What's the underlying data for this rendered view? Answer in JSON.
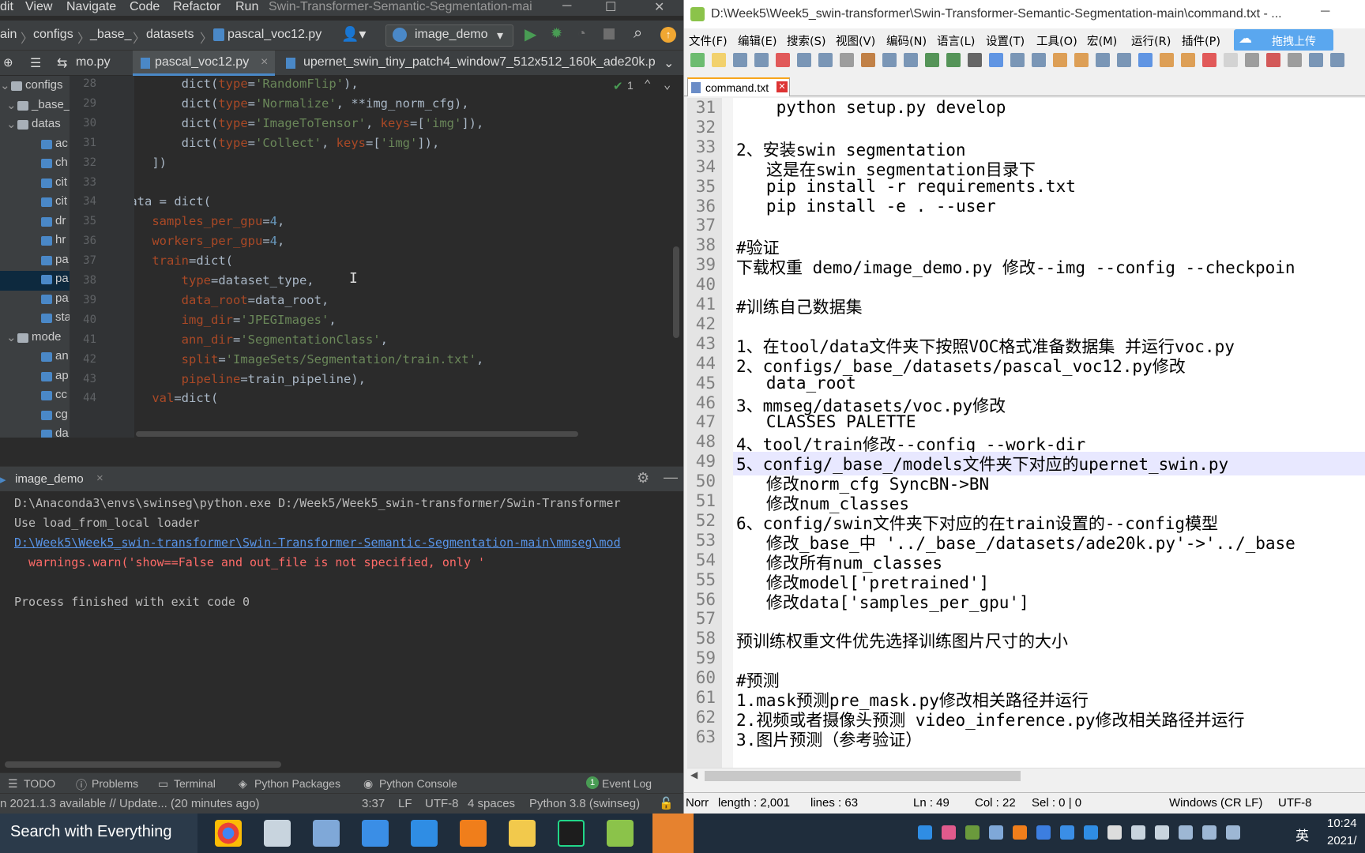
{
  "ide": {
    "menu": [
      "dit",
      "View",
      "Navigate",
      "Code",
      "Refactor",
      "Run"
    ],
    "window_title": "Swin-Transformer-Semantic-Segmentation-mai",
    "breadcrumbs": [
      "ain",
      "configs",
      "_base_",
      "datasets",
      "pascal_voc12.py"
    ],
    "run_config": "image_demo",
    "tabs": [
      "mo.py",
      "pascal_voc12.py",
      "upernet_swin_tiny_patch4_window7_512x512_160k_ade20k.p"
    ],
    "inspection_count": "1",
    "tree": [
      {
        "label": "configs",
        "indent": 0,
        "icon": "folder",
        "sel": false
      },
      {
        "label": "_base_",
        "indent": 1,
        "icon": "folder",
        "sel": false
      },
      {
        "label": "datas",
        "indent": 1,
        "icon": "folder",
        "sel": false
      },
      {
        "label": "ac",
        "indent": 2,
        "icon": "py",
        "sel": false
      },
      {
        "label": "ch",
        "indent": 2,
        "icon": "py",
        "sel": false
      },
      {
        "label": "cit",
        "indent": 2,
        "icon": "py",
        "sel": false
      },
      {
        "label": "cit",
        "indent": 2,
        "icon": "py",
        "sel": false
      },
      {
        "label": "dr",
        "indent": 2,
        "icon": "py",
        "sel": false
      },
      {
        "label": "hr",
        "indent": 2,
        "icon": "py",
        "sel": false
      },
      {
        "label": "pa",
        "indent": 2,
        "icon": "py",
        "sel": false
      },
      {
        "label": "pa",
        "indent": 2,
        "icon": "py",
        "sel": true
      },
      {
        "label": "pa",
        "indent": 2,
        "icon": "py",
        "sel": false
      },
      {
        "label": "sta",
        "indent": 2,
        "icon": "py",
        "sel": false
      },
      {
        "label": "mode",
        "indent": 1,
        "icon": "folder",
        "sel": false
      },
      {
        "label": "an",
        "indent": 2,
        "icon": "py",
        "sel": false
      },
      {
        "label": "ap",
        "indent": 2,
        "icon": "py",
        "sel": false
      },
      {
        "label": "cc",
        "indent": 2,
        "icon": "py",
        "sel": false
      },
      {
        "label": "cg",
        "indent": 2,
        "icon": "py",
        "sel": false
      },
      {
        "label": "da",
        "indent": 2,
        "icon": "py",
        "sel": false
      },
      {
        "label": "de",
        "indent": 2,
        "icon": "py",
        "sel": false
      }
    ],
    "line_numbers": [
      "28",
      "29",
      "30",
      "31",
      "32",
      "33",
      "34",
      "35",
      "36",
      "37",
      "38",
      "39",
      "40",
      "41",
      "42",
      "43",
      "44"
    ],
    "code": [
      [
        [
          "        dict(",
          ""
        ],
        [
          "type",
          "pa"
        ],
        [
          "=",
          ""
        ],
        [
          "'RandomFlip'",
          "st"
        ],
        [
          "),",
          ""
        ]
      ],
      [
        [
          "        dict(",
          ""
        ],
        [
          "type",
          "pa"
        ],
        [
          "=",
          ""
        ],
        [
          "'Normalize'",
          "st"
        ],
        [
          ", **img_norm_cfg),",
          ""
        ]
      ],
      [
        [
          "        dict(",
          ""
        ],
        [
          "type",
          "pa"
        ],
        [
          "=",
          ""
        ],
        [
          "'ImageToTensor'",
          "st"
        ],
        [
          ", ",
          ""
        ],
        [
          "keys",
          "pa"
        ],
        [
          "=[",
          ""
        ],
        [
          "'img'",
          "st"
        ],
        [
          "]),",
          ""
        ]
      ],
      [
        [
          "        dict(",
          ""
        ],
        [
          "type",
          "pa"
        ],
        [
          "=",
          ""
        ],
        [
          "'Collect'",
          "st"
        ],
        [
          ", ",
          ""
        ],
        [
          "keys",
          "pa"
        ],
        [
          "=[",
          ""
        ],
        [
          "'img'",
          "st"
        ],
        [
          "]),",
          ""
        ]
      ],
      [
        [
          "    ])",
          ""
        ]
      ],
      [
        [
          "]",
          ""
        ]
      ],
      [
        [
          "data = dict(",
          ""
        ]
      ],
      [
        [
          "    ",
          ""
        ],
        [
          "samples_per_gpu",
          "pa"
        ],
        [
          "=",
          ""
        ],
        [
          "4",
          "nm"
        ],
        [
          ",",
          ""
        ]
      ],
      [
        [
          "    ",
          ""
        ],
        [
          "workers_per_gpu",
          "pa"
        ],
        [
          "=",
          ""
        ],
        [
          "4",
          "nm"
        ],
        [
          ",",
          ""
        ]
      ],
      [
        [
          "    ",
          ""
        ],
        [
          "train",
          "pa"
        ],
        [
          "=dict(",
          ""
        ]
      ],
      [
        [
          "        ",
          ""
        ],
        [
          "type",
          "pa"
        ],
        [
          "=dataset_type,",
          ""
        ]
      ],
      [
        [
          "        ",
          ""
        ],
        [
          "data_root",
          "pa"
        ],
        [
          "=data_root,",
          ""
        ]
      ],
      [
        [
          "        ",
          ""
        ],
        [
          "img_dir",
          "pa"
        ],
        [
          "=",
          ""
        ],
        [
          "'JPEGImages'",
          "st"
        ],
        [
          ",",
          ""
        ]
      ],
      [
        [
          "        ",
          ""
        ],
        [
          "ann_dir",
          "pa"
        ],
        [
          "=",
          ""
        ],
        [
          "'SegmentationClass'",
          "st"
        ],
        [
          ",",
          ""
        ]
      ],
      [
        [
          "        ",
          ""
        ],
        [
          "split",
          "pa"
        ],
        [
          "=",
          ""
        ],
        [
          "'ImageSets/Segmentation/train.txt'",
          "st"
        ],
        [
          ",",
          ""
        ]
      ],
      [
        [
          "        ",
          ""
        ],
        [
          "pipeline",
          "pa"
        ],
        [
          "=train_pipeline),",
          ""
        ]
      ],
      [
        [
          "    ",
          ""
        ],
        [
          "val",
          "pa"
        ],
        [
          "=dict(",
          ""
        ]
      ]
    ],
    "run_tab": "image_demo",
    "console": [
      {
        "text": "D:\\Anaconda3\\envs\\swinseg\\python.exe D:/Week5/Week5_swin-transformer/Swin-Transformer",
        "kind": "plain"
      },
      {
        "text": "Use load_from_local loader",
        "kind": "plain"
      },
      {
        "text": "D:\\Week5\\Week5_swin-transformer\\Swin-Transformer-Semantic-Segmentation-main\\mmseg\\mod",
        "kind": "link"
      },
      {
        "text": "  warnings.warn('show==False and out_file is not specified, only '",
        "kind": "warn"
      },
      {
        "text": "",
        "kind": "plain"
      },
      {
        "text": "Process finished with exit code 0",
        "kind": "plain"
      }
    ],
    "tool_windows": [
      "TODO",
      "Problems",
      "Terminal",
      "Python Packages",
      "Python Console",
      "Event Log"
    ],
    "status_left": "n 2021.1.3 available // Update... (20 minutes ago)",
    "status_right": [
      "3:37",
      "LF",
      "UTF-8",
      "4 spaces",
      "Python 3.8 (swinseg)"
    ]
  },
  "npp": {
    "title": "D:\\Week5\\Week5_swin-transformer\\Swin-Transformer-Semantic-Segmentation-main\\command.txt - ...",
    "menu": [
      "文件(F)",
      "编辑(E)",
      "搜索(S)",
      "视图(V)",
      "编码(N)",
      "语言(L)",
      "设置(T)",
      "工具(O)",
      "宏(M)",
      "运行(R)",
      "插件(P)"
    ],
    "cloud_button": "拖拽上传",
    "tab": "command.txt",
    "highlight_line": 49,
    "lines": [
      {
        "n": "31",
        "t": "    python setup.py develop"
      },
      {
        "n": "32",
        "t": ""
      },
      {
        "n": "33",
        "t": "2、安装swin segmentation"
      },
      {
        "n": "34",
        "t": "   这是在swin segmentation目录下"
      },
      {
        "n": "35",
        "t": "   pip install -r requirements.txt"
      },
      {
        "n": "36",
        "t": "   pip install -e . --user"
      },
      {
        "n": "37",
        "t": ""
      },
      {
        "n": "38",
        "t": "#验证"
      },
      {
        "n": "39",
        "t": "下载权重 demo/image_demo.py 修改--img --config --checkpoin"
      },
      {
        "n": "40",
        "t": ""
      },
      {
        "n": "41",
        "t": "#训练自己数据集"
      },
      {
        "n": "42",
        "t": ""
      },
      {
        "n": "43",
        "t": "1、在tool/data文件夹下按照VOC格式准备数据集 并运行voc.py"
      },
      {
        "n": "44",
        "t": "2、configs/_base_/datasets/pascal_voc12.py修改"
      },
      {
        "n": "45",
        "t": "   data_root"
      },
      {
        "n": "46",
        "t": "3、mmseg/datasets/voc.py修改"
      },
      {
        "n": "47",
        "t": "   CLASSES PALETTE"
      },
      {
        "n": "48",
        "t": "4、tool/train修改--config --work-dir"
      },
      {
        "n": "49",
        "t": "5、config/_base_/models文件夹下对应的upernet_swin.py"
      },
      {
        "n": "50",
        "t": "   修改norm_cfg SyncBN->BN"
      },
      {
        "n": "51",
        "t": "   修改num_classes"
      },
      {
        "n": "52",
        "t": "6、config/swin文件夹下对应的在train设置的--config模型"
      },
      {
        "n": "53",
        "t": "   修改_base_中 '../_base_/datasets/ade20k.py'->'../_base"
      },
      {
        "n": "54",
        "t": "   修改所有num_classes"
      },
      {
        "n": "55",
        "t": "   修改model['pretrained']"
      },
      {
        "n": "56",
        "t": "   修改data['samples_per_gpu']"
      },
      {
        "n": "57",
        "t": ""
      },
      {
        "n": "58",
        "t": "预训练权重文件优先选择训练图片尺寸的大小"
      },
      {
        "n": "59",
        "t": ""
      },
      {
        "n": "60",
        "t": "#预测"
      },
      {
        "n": "61",
        "t": "1.mask预测pre_mask.py修改相关路径并运行"
      },
      {
        "n": "62",
        "t": "2.视频或者摄像头预测 video_inference.py修改相关路径并运行"
      },
      {
        "n": "63",
        "t": "3.图片预测（参考验证）"
      }
    ],
    "status": {
      "type": "Norr",
      "length": "length : 2,001",
      "lines": "lines : 63",
      "ln": "Ln : 49",
      "col": "Col : 22",
      "sel": "Sel : 0 | 0",
      "eol": "Windows (CR LF)",
      "enc": "UTF-8"
    }
  },
  "taskbar": {
    "search": "Search with Everything",
    "ime": "英",
    "time": "10:24",
    "date": "2021/"
  },
  "colors": {
    "ide_bg": "#2b2b2b",
    "ide_panel": "#3c3f41",
    "accent_blue": "#4a88c7",
    "warn_red": "#ff6b68",
    "link_blue": "#5894e8",
    "npp_highlight": "#e8e8ff",
    "taskbar_bg": "#1f2d3c"
  }
}
